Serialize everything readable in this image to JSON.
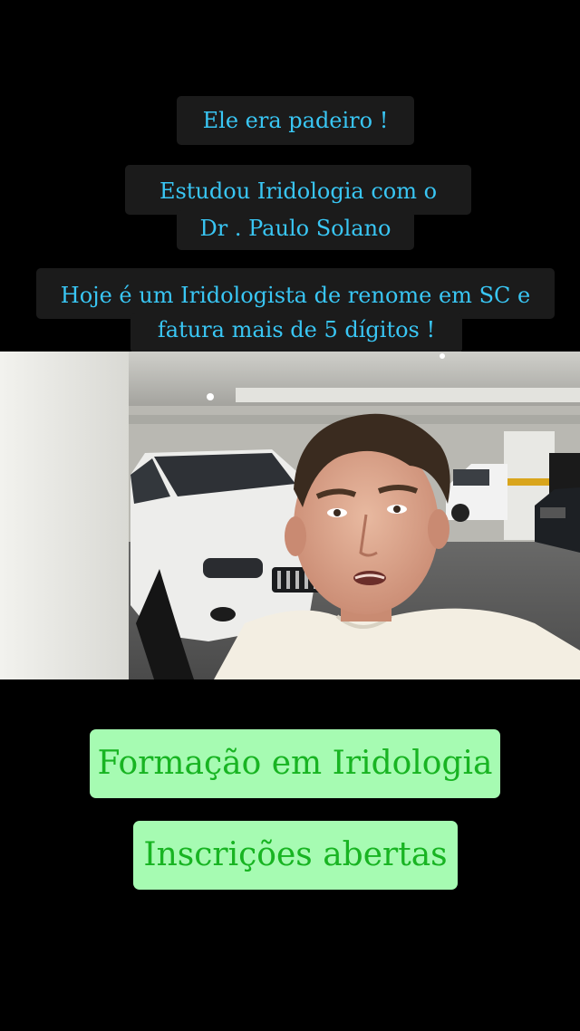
{
  "captions": {
    "line1": "Ele  era  padeiro  !",
    "line2": "Estudou  Iridologia  com  o",
    "line3": "Dr . Paulo  Solano",
    "line4": "Hoje é um Iridologista de renome em SC e",
    "line5": "fatura mais  de  5 dígitos !"
  },
  "buttons": {
    "course": "Formação em Iridologia",
    "enroll": "Inscrições abertas"
  },
  "colors": {
    "caption_text": "#39c6f4",
    "caption_bg": "#1b1b1b",
    "button_bg": "#a6fbb2",
    "button_text": "#18b422"
  }
}
